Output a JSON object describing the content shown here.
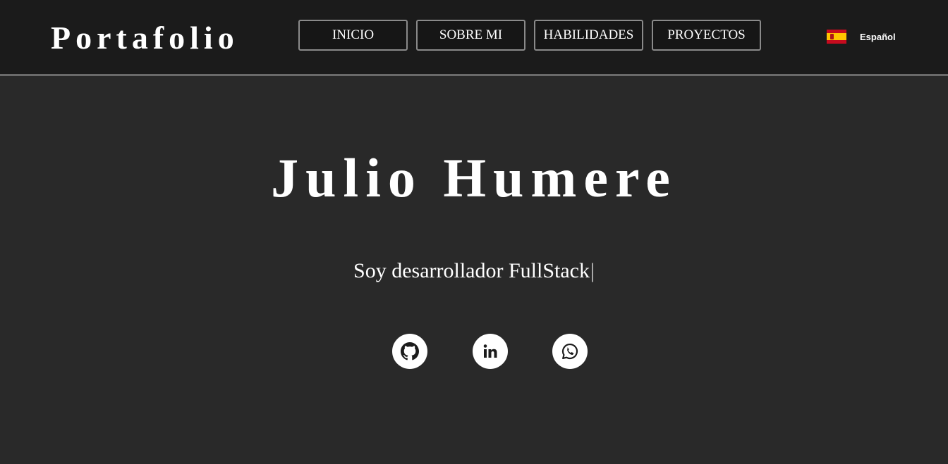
{
  "navbar": {
    "brand": "Portafolio",
    "items": [
      {
        "label": "INICIO"
      },
      {
        "label": "SOBRE MI"
      },
      {
        "label": "HABILIDADES"
      },
      {
        "label": "PROYECTOS"
      }
    ],
    "language": {
      "label": "Español",
      "flag": "spain-flag-icon"
    }
  },
  "hero": {
    "name": "Julio Humere",
    "tagline": "Soy desarrollador FullStack",
    "cursor": "|"
  },
  "social": {
    "icons": [
      "github-icon",
      "linkedin-icon",
      "whatsapp-icon"
    ]
  },
  "colors": {
    "page_background": "#292929",
    "navbar_background": "#1b1b1b",
    "navbar_border": "#6a6a6a",
    "text": "#ffffff"
  }
}
